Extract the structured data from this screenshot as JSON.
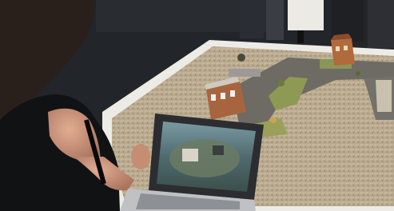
{
  "scene": {
    "subject": "photo",
    "colors": {
      "floor": "#23262b",
      "table_frame": "#efefe9",
      "gravel": "#b7a78c",
      "road": "#6f6c66",
      "grass": "#8f9a55",
      "hair": "#2a211c",
      "top": "#111214",
      "skin": "#c9957b",
      "tablet_bezel": "#2b2c2f",
      "tablet_screen": "#4d6f7a"
    }
  }
}
